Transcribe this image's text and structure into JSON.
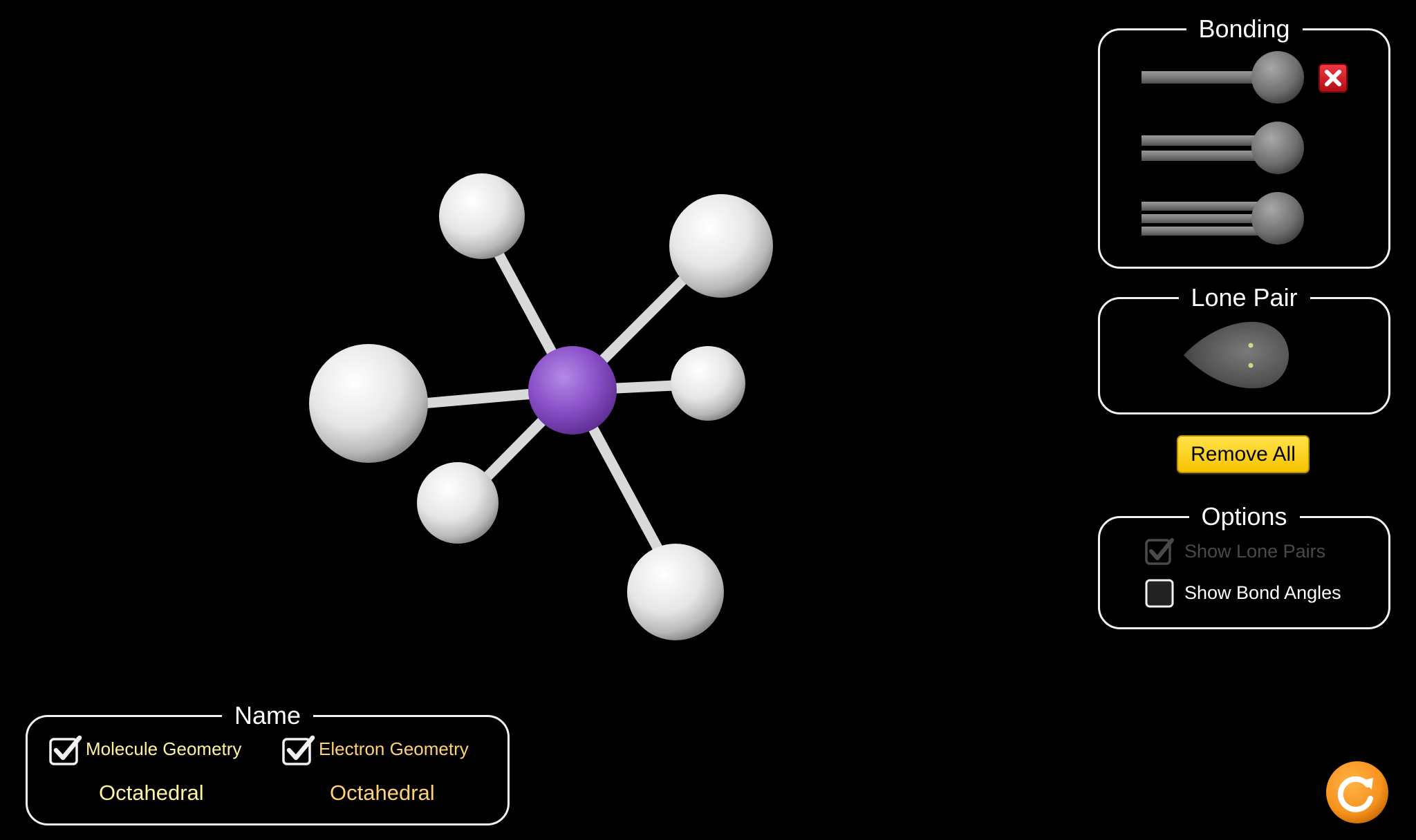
{
  "bonding": {
    "title": "Bonding",
    "items": [
      "single-bond",
      "double-bond",
      "triple-bond"
    ],
    "remove_icon": "close-icon"
  },
  "lone_pair": {
    "title": "Lone Pair",
    "icon": "lone-pair-icon"
  },
  "remove_all_label": "Remove All",
  "options": {
    "title": "Options",
    "show_lone_pairs": {
      "label": "Show Lone Pairs",
      "checked": true,
      "enabled": false
    },
    "show_bond_angles": {
      "label": "Show Bond Angles",
      "checked": false,
      "enabled": true
    }
  },
  "name_panel": {
    "title": "Name",
    "molecule_geometry": {
      "label": "Molecule Geometry",
      "checked": true,
      "value": "Octahedral"
    },
    "electron_geometry": {
      "label": "Electron Geometry",
      "checked": true,
      "value": "Octahedral"
    }
  },
  "molecule": {
    "central_atom_color": "#8a4fc8",
    "outer_atom_color": "#eeeeee",
    "bond_color": "#d9d9d9",
    "outer_atom_count": 6
  },
  "colors": {
    "background": "#000000",
    "accent_yellow": "#f5c400",
    "remove_red": "#d8121e",
    "reset_orange": "#f7921e",
    "molecule_label_color": "#fff5a0",
    "electron_label_color": "#ffd27a"
  },
  "reset_icon": "reset-icon"
}
